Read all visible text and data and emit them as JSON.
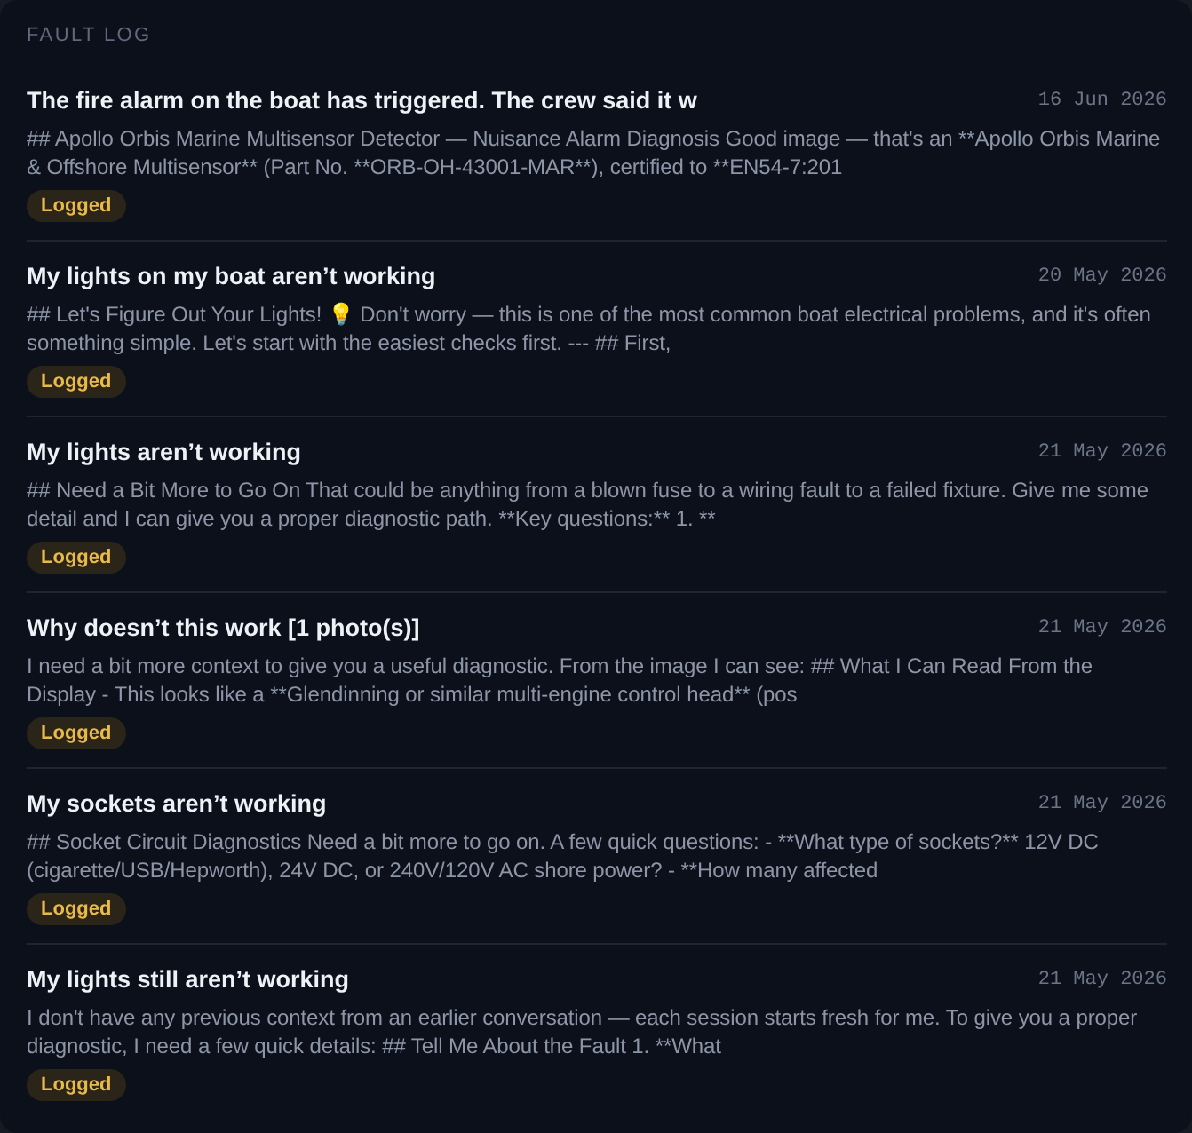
{
  "header": {
    "title": "FAULT LOG"
  },
  "entries": [
    {
      "title": "The fire alarm on the boat has triggered. The crew said it w",
      "date": "16 Jun 2026",
      "preview": "## Apollo Orbis Marine Multisensor Detector — Nuisance Alarm Diagnosis Good image — that's an **Apollo Orbis Marine & Offshore Multisensor** (Part No. **ORB-OH-43001-MAR**), certified to **EN54-7:201",
      "status": {
        "label": "Logged",
        "kind": "logged"
      }
    },
    {
      "title": "My lights on my boat aren’t working",
      "date": "20 May 2026",
      "preview": "## Let's Figure Out Your Lights! 💡 Don't worry — this is one of the most common boat electrical problems, and it's often something simple. Let's start with the easiest checks first. --- ## First,",
      "status": {
        "label": "Logged",
        "kind": "logged"
      }
    },
    {
      "title": "My lights aren’t working",
      "date": "21 May 2026",
      "preview": "## Need a Bit More to Go On That could be anything from a blown fuse to a wiring fault to a failed fixture. Give me some detail and I can give you a proper diagnostic path. **Key questions:** 1. **",
      "status": {
        "label": "Logged",
        "kind": "logged"
      }
    },
    {
      "title": "Why doesn’t this work [1 photo(s)]",
      "date": "21 May 2026",
      "preview": "I need a bit more context to give you a useful diagnostic. From the image I can see: ## What I Can Read From the Display - This looks like a **Glendinning or similar multi-engine control head** (pos",
      "status": {
        "label": "Logged",
        "kind": "logged"
      }
    },
    {
      "title": "My sockets aren’t working",
      "date": "21 May 2026",
      "preview": "## Socket Circuit Diagnostics Need a bit more to go on. A few quick questions: - **What type of sockets?** 12V DC (cigarette/USB/Hepworth), 24V DC, or 240V/120V AC shore power? - **How many affected",
      "status": {
        "label": "Logged",
        "kind": "logged"
      }
    },
    {
      "title": "My lights still aren’t working",
      "date": "21 May 2026",
      "preview": "I don't have any previous context from an earlier conversation — each session starts fresh for me. To give you a proper diagnostic, I need a few quick details: ## Tell Me About the Fault 1. **What",
      "status": {
        "label": "Logged",
        "kind": "logged"
      }
    }
  ]
}
